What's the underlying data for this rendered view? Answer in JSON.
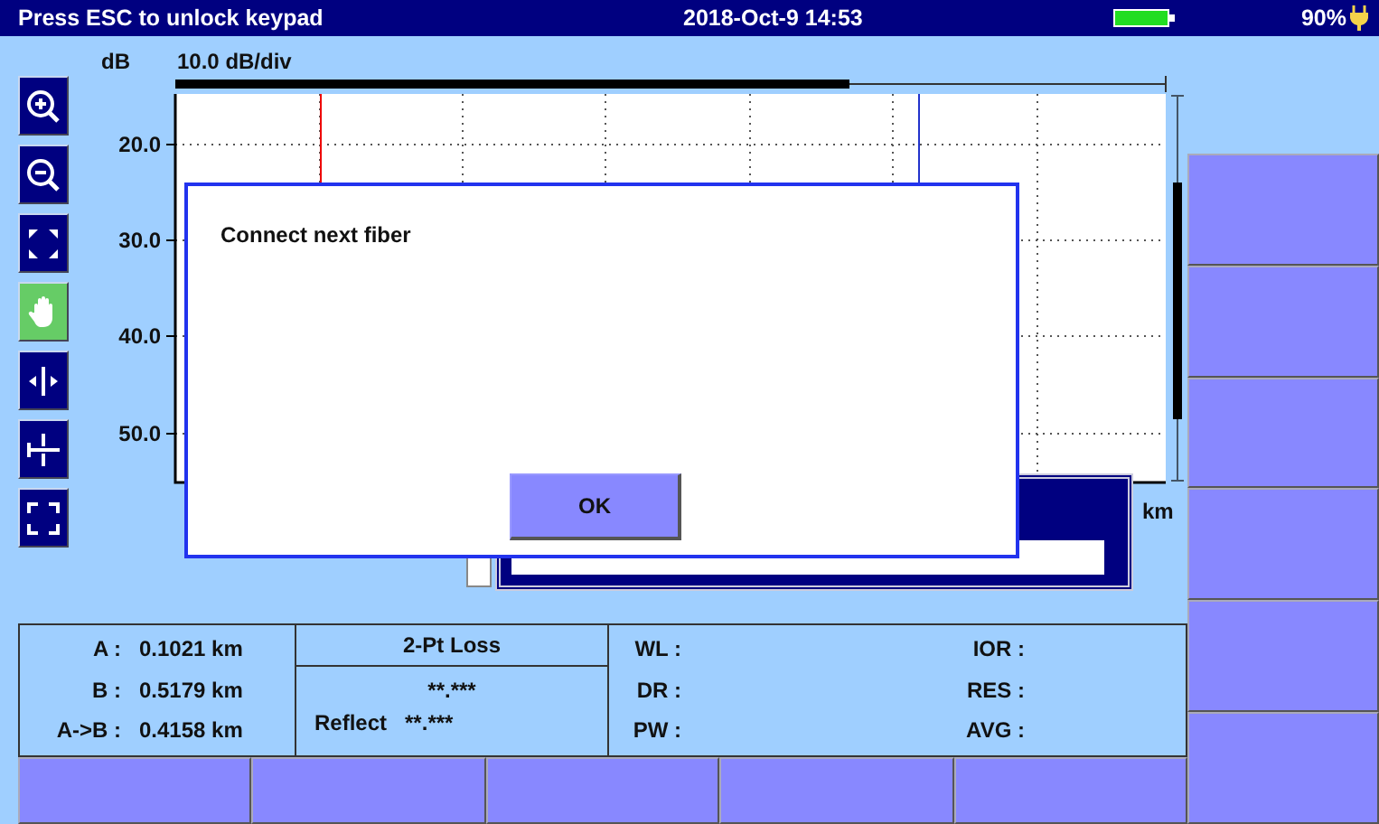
{
  "status_bar": {
    "message": "Press ESC to unlock keypad",
    "datetime": "2018-Oct-9 14:53",
    "battery": "90%"
  },
  "graph": {
    "y_unit": "dB",
    "scale": "10.0 dB/div",
    "y_labels": [
      "20.0",
      "30.0",
      "40.0",
      "50.0"
    ],
    "x_unit": "km"
  },
  "tools": [
    {
      "kind": "zoom-in",
      "selected": false
    },
    {
      "kind": "zoom-out",
      "selected": false
    },
    {
      "kind": "fit",
      "selected": false
    },
    {
      "kind": "hand",
      "selected": true
    },
    {
      "kind": "split",
      "selected": false
    },
    {
      "kind": "cross",
      "selected": false
    },
    {
      "kind": "frame",
      "selected": false
    }
  ],
  "dialog": {
    "message": "Connect next fiber",
    "button": "OK"
  },
  "markers": [
    {
      "label": "A :",
      "value": "0.1021 km"
    },
    {
      "label": "B :",
      "value": "0.5179 km"
    },
    {
      "label": "A->B :",
      "value": "0.4158 km"
    }
  ],
  "loss": {
    "title": "2-Pt Loss",
    "value": "**.***",
    "reflect_label": "Reflect",
    "reflect_value": "**.***"
  },
  "params_left": [
    "WL :",
    "DR :",
    "PW :"
  ],
  "params_right": [
    "IOR :",
    "RES :",
    "AVG :"
  ]
}
